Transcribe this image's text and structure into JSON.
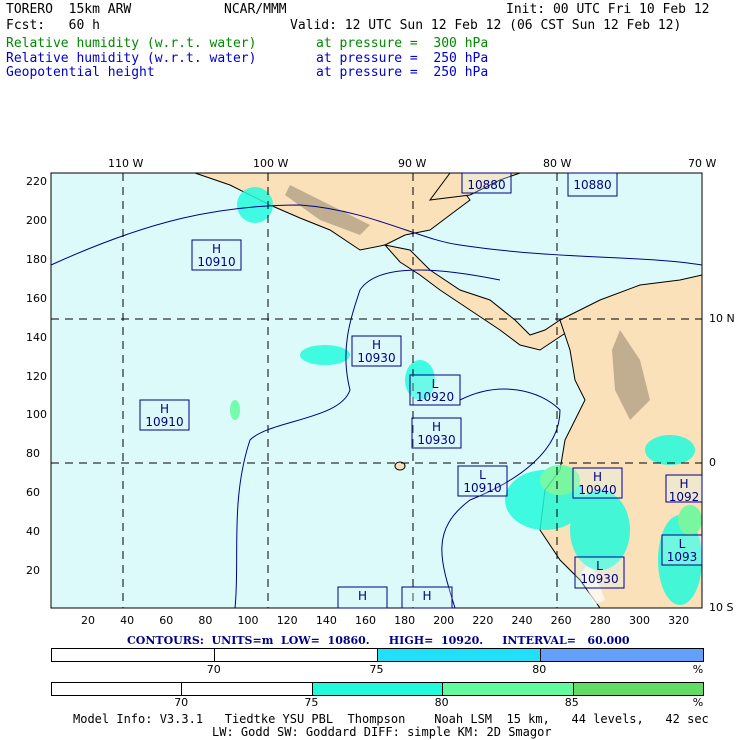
{
  "header": {
    "model": "TORERO  15km ARW",
    "org": "NCAR/MMM",
    "init": "Init: 00 UTC Fri 10 Feb 12",
    "fcst": "Fcst:   60 h",
    "valid": "Valid: 12 UTC Sun 12 Feb 12 (06 CST Sun 12 Feb 12)",
    "fields": [
      {
        "name": "Relative humidity (w.r.t. water)",
        "level": "at pressure =  300 hPa",
        "color": "#008800"
      },
      {
        "name": "Relative humidity (w.r.t. water)",
        "level": "at pressure =  250 hPa",
        "color": "#0000cc"
      },
      {
        "name": "Geopotential height",
        "level": "at pressure =  250 hPa",
        "color": "#0000cc"
      }
    ]
  },
  "map": {
    "lon_labels": [
      "110 W",
      "100 W",
      "90 W",
      "80 W",
      "70 W"
    ],
    "lat_labels": [
      "10 N",
      "0",
      "10 S"
    ],
    "y_ticks": [
      "220",
      "200",
      "180",
      "160",
      "140",
      "120",
      "100",
      "80",
      "60",
      "40",
      "20"
    ],
    "x_ticks": [
      "20",
      "40",
      "60",
      "80",
      "100",
      "120",
      "140",
      "160",
      "180",
      "200",
      "220",
      "240",
      "260",
      "280",
      "300",
      "320"
    ],
    "colors": {
      "ocean": "#dcfafa",
      "land": "#fae1b9",
      "contour": "#000088"
    },
    "centers": [
      {
        "type": "",
        "value": "10880"
      },
      {
        "type": "",
        "value": "10880"
      },
      {
        "type": "H",
        "value": "10910"
      },
      {
        "type": "H",
        "value": "10930"
      },
      {
        "type": "L",
        "value": "10920"
      },
      {
        "type": "H",
        "value": "10910"
      },
      {
        "type": "H",
        "value": "10930"
      },
      {
        "type": "L",
        "value": "10910"
      },
      {
        "type": "H",
        "value": "10940"
      },
      {
        "type": "H",
        "value": "1092"
      },
      {
        "type": "L",
        "value": "1093"
      },
      {
        "type": "L",
        "value": "10930"
      },
      {
        "type": "H",
        "value": ""
      },
      {
        "type": "H",
        "value": ""
      }
    ]
  },
  "contours": "CONTOURS:  UNITS=m  LOW=  10860.     HIGH=  10920.     INTERVAL=   60.000",
  "legend250": {
    "ticks": [
      "70",
      "75",
      "80",
      "%"
    ],
    "colors": [
      "#ffffff",
      "#ffffff",
      "#22e0fa",
      "#62a0fa"
    ]
  },
  "legend300": {
    "ticks": [
      "70",
      "75",
      "80",
      "85",
      "%"
    ],
    "colors": [
      "#ffffff",
      "#ffffff",
      "#22fadc",
      "#62fa9c",
      "#62dc62"
    ]
  },
  "footer": {
    "line1": "Model Info: V3.3.1   Tiedtke YSU PBL  Thompson    Noah LSM  15 km,   44 levels,   42 sec",
    "line2": "LW: Godd SW: Goddard DIFF: simple KM: 2D Smagor"
  }
}
